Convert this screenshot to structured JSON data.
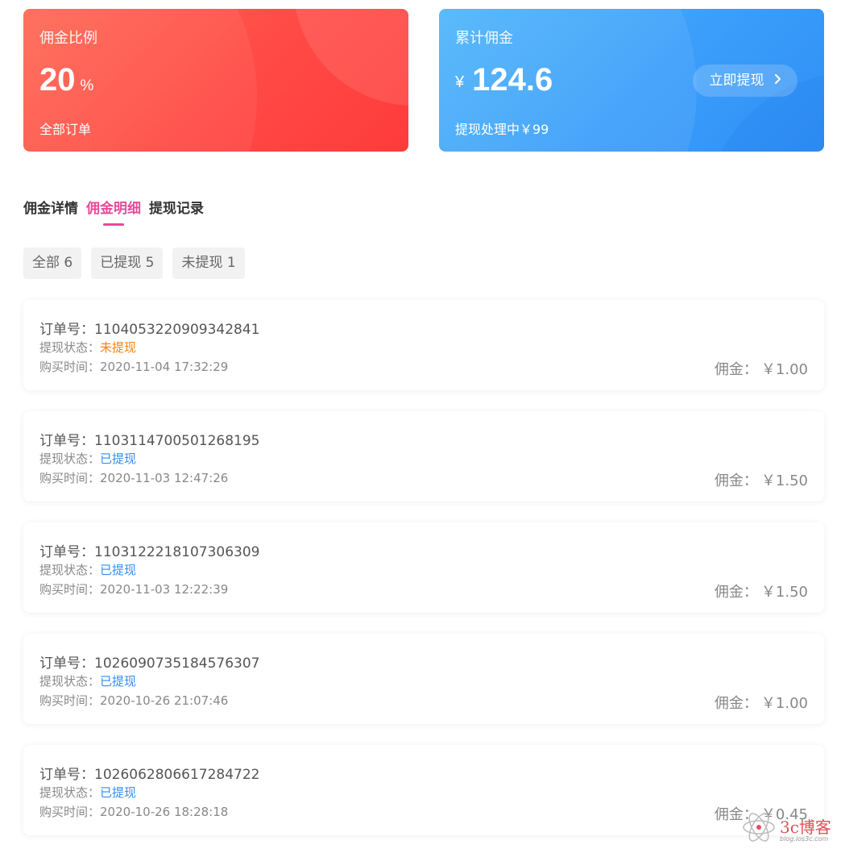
{
  "commission_rate_card": {
    "label": "佣金比例",
    "value": "20",
    "unit": "%",
    "link": "全部订单"
  },
  "total_commission_card": {
    "label": "累计佣金",
    "currency": "¥",
    "value": "124.6",
    "withdraw_button": "立即提现",
    "pending_text": "提现处理中￥99"
  },
  "tabs": [
    {
      "label": "佣金详情",
      "active": false
    },
    {
      "label": "佣金明细",
      "active": true
    },
    {
      "label": "提现记录",
      "active": false
    }
  ],
  "filters": [
    {
      "label": "全部 6"
    },
    {
      "label": "已提现 5"
    },
    {
      "label": "未提现 1"
    }
  ],
  "orders": [
    {
      "order_label": "订单号：",
      "order_no": "1104053220909342841",
      "status_label": "提现状态：",
      "status": "未提现",
      "time_label": "购买时间：",
      "time": "2020-11-04 17:32:29",
      "amount_label": "佣金：",
      "amount": "￥1.00"
    },
    {
      "order_label": "订单号：",
      "order_no": "1103114700501268195",
      "status_label": "提现状态：",
      "status": "已提现",
      "time_label": "购买时间：",
      "time": "2020-11-03 12:47:26",
      "amount_label": "佣金：",
      "amount": "￥1.50"
    },
    {
      "order_label": "订单号：",
      "order_no": "1103122218107306309",
      "status_label": "提现状态：",
      "status": "已提现",
      "time_label": "购买时间：",
      "time": "2020-11-03 12:22:39",
      "amount_label": "佣金：",
      "amount": "￥1.50"
    },
    {
      "order_label": "订单号：",
      "order_no": "1026090735184576307",
      "status_label": "提现状态：",
      "status": "已提现",
      "time_label": "购买时间：",
      "time": "2020-10-26 21:07:46",
      "amount_label": "佣金：",
      "amount": "￥1.00"
    },
    {
      "order_label": "订单号：",
      "order_no": "1026062806617284722",
      "status_label": "提现状态：",
      "status": "已提现",
      "time_label": "购买时间：",
      "time": "2020-10-26 18:28:18",
      "amount_label": "佣金：",
      "amount": "￥0.45"
    }
  ],
  "watermark": {
    "text": "3c博客",
    "sub": "blog.ios3c.com"
  },
  "colors": {
    "accent_pink": "#e84a98",
    "pending_orange": "#ff7f0e",
    "done_blue": "#2f8ff5",
    "card_red": "#fe3b3b",
    "card_blue": "#2f8ff5"
  }
}
